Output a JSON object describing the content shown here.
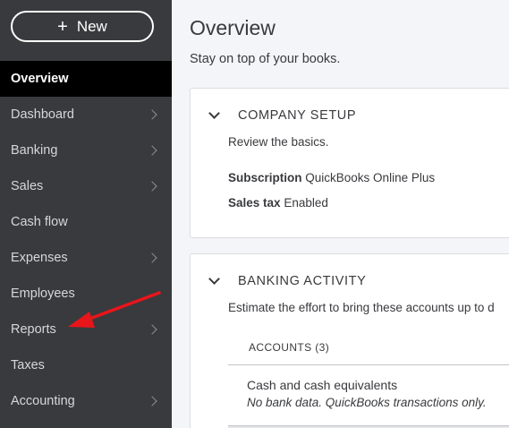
{
  "sidebar": {
    "new_button_label": "New",
    "items": [
      {
        "label": "Overview",
        "active": true,
        "chevron": false
      },
      {
        "label": "Dashboard",
        "active": false,
        "chevron": true
      },
      {
        "label": "Banking",
        "active": false,
        "chevron": true
      },
      {
        "label": "Sales",
        "active": false,
        "chevron": true
      },
      {
        "label": "Cash flow",
        "active": false,
        "chevron": false
      },
      {
        "label": "Expenses",
        "active": false,
        "chevron": true
      },
      {
        "label": "Employees",
        "active": false,
        "chevron": false
      },
      {
        "label": "Reports",
        "active": false,
        "chevron": true
      },
      {
        "label": "Taxes",
        "active": false,
        "chevron": false
      },
      {
        "label": "Accounting",
        "active": false,
        "chevron": true
      }
    ]
  },
  "main": {
    "title": "Overview",
    "subtitle": "Stay on top of your books.",
    "company_setup": {
      "title": "COMPANY SETUP",
      "description": "Review the basics.",
      "subscription_label": "Subscription",
      "subscription_value": "QuickBooks Online Plus",
      "sales_tax_label": "Sales tax",
      "sales_tax_value": "Enabled"
    },
    "banking_activity": {
      "title": "BANKING ACTIVITY",
      "description": "Estimate the effort to bring these accounts up to d",
      "accounts_header": "ACCOUNTS (3)",
      "accounts": [
        {
          "name": "Cash and cash equivalents",
          "note": "No bank data. QuickBooks transactions only."
        }
      ]
    }
  },
  "colors": {
    "sidebar_bg": "#393a3d",
    "active_item_bg": "#000000",
    "annotation_arrow": "#e8151b"
  },
  "icons": {
    "new": "plus-icon",
    "nav_chevron": "chevron-right-icon",
    "card_toggle": "chevron-down-icon",
    "annotation": "red-arrow-annotation"
  }
}
